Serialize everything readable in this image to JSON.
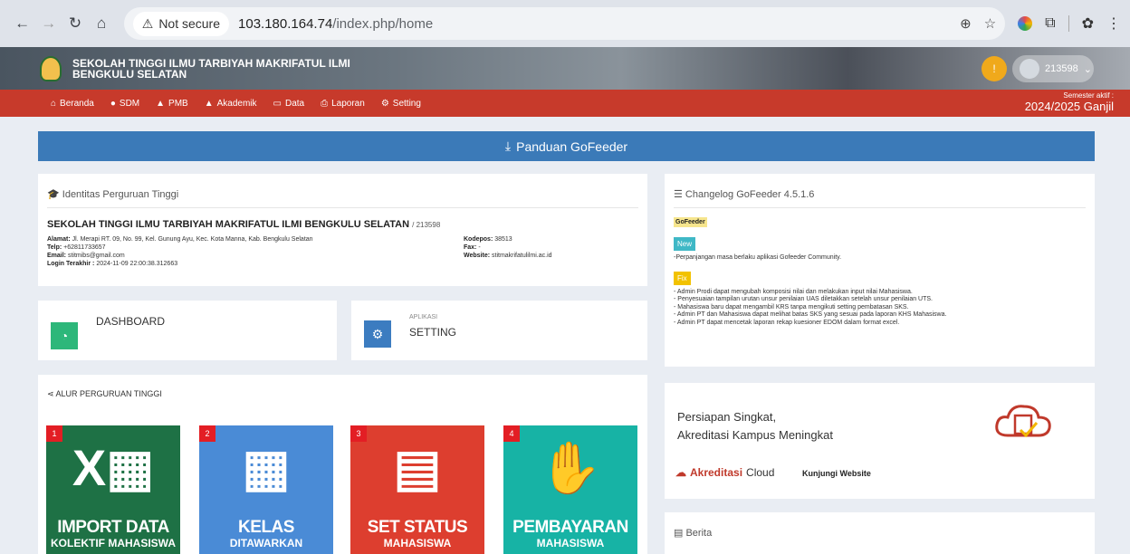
{
  "browser": {
    "security_label": "Not secure",
    "url_host": "103.180.164.74",
    "url_path": "/index.php/home"
  },
  "header": {
    "site_title": "SEKOLAH TINGGI ILMU TARBIYAH MAKRIFATUL ILMI BENGKULU SELATAN",
    "user": "213598"
  },
  "menu": {
    "items": [
      {
        "label": "Beranda",
        "icon": "home-icon"
      },
      {
        "label": "SDM",
        "icon": "user-icon"
      },
      {
        "label": "PMB",
        "icon": "graduation-cap-icon"
      },
      {
        "label": "Akademik",
        "icon": "graduation-cap-icon"
      },
      {
        "label": "Data",
        "icon": "folder-icon"
      },
      {
        "label": "Laporan",
        "icon": "printer-icon"
      },
      {
        "label": "Setting",
        "icon": "gear-icon"
      }
    ],
    "semester_label": "Semester aktif :",
    "semester_value": "2024/2025 Ganjil"
  },
  "panduan_label": "Panduan GoFeeder",
  "identitas": {
    "heading": "Identitas Perguruan Tinggi",
    "name": "SEKOLAH TINGGI ILMU TARBIYAH MAKRIFATUL ILMI BENGKULU SELATAN",
    "code": "/ 213598",
    "alamat_label": "Alamat:",
    "alamat": "Jl. Merapi RT. 09, No. 99, Kel. Gunung Ayu, Kec. Kota Manna, Kab. Bengkulu Selatan",
    "telp_label": "Telp:",
    "telp": "+62811733657",
    "email_label": "Email:",
    "email": "stitmibs@gmail.com",
    "login_label": "Login Terakhir :",
    "login": "2024-11-09 22:00:38.312663",
    "kodepos_label": "Kodepos:",
    "kodepos": "38513",
    "fax_label": "Fax:",
    "fax": "-",
    "website_label": "Website:",
    "website": "stitmakrifatulilmi.ac.id"
  },
  "changelog": {
    "heading": "Changelog GoFeeder 4.5.1.6",
    "tag": "GoFeeder",
    "new_label": "New",
    "new_items": [
      "-Perpanjangan masa berlaku aplikasi Gofeeder Community."
    ],
    "fix_label": "Fix",
    "fix_items": [
      "- Admin Prodi dapat mengubah komposisi nilai dan melakukan input nilai Mahasiswa.",
      "- Penyesuaian tampilan urutan unsur penilaian UAS diletakkan setelah unsur penilaian UTS.",
      "- Mahasiswa baru dapat mengambil KRS tanpa mengikuti setting pembatasan SKS.",
      "- Admin PT dan Mahasiswa dapat melihat batas SKS yang sesuai pada laporan KHS Mahasiswa.",
      "- Admin PT dapat mencetak laporan rekap kuesioner EDOM dalam format excel."
    ]
  },
  "dashboard_label": "DASHBOARD",
  "aplikasi": {
    "sub": "APLIKASI",
    "title": "SETTING"
  },
  "alur": {
    "heading": "ALUR PERGURUAN TINGGI",
    "steps": [
      {
        "num": "1",
        "t1": "IMPORT DATA",
        "t2": "KOLEKTIF MAHASISWA"
      },
      {
        "num": "2",
        "t1": "KELAS",
        "t2": "DITAWARKAN"
      },
      {
        "num": "3",
        "t1": "SET STATUS",
        "t2": "MAHASISWA"
      },
      {
        "num": "4",
        "t1": "PEMBAYARAN",
        "t2": "MAHASISWA"
      }
    ]
  },
  "promo": {
    "line1": "Persiapan Singkat,",
    "line2": "Akreditasi Kampus Meningkat",
    "brand": "Akreditasi",
    "brand2": "Cloud",
    "link": "Kunjungi Website"
  },
  "berita_heading": "Berita"
}
